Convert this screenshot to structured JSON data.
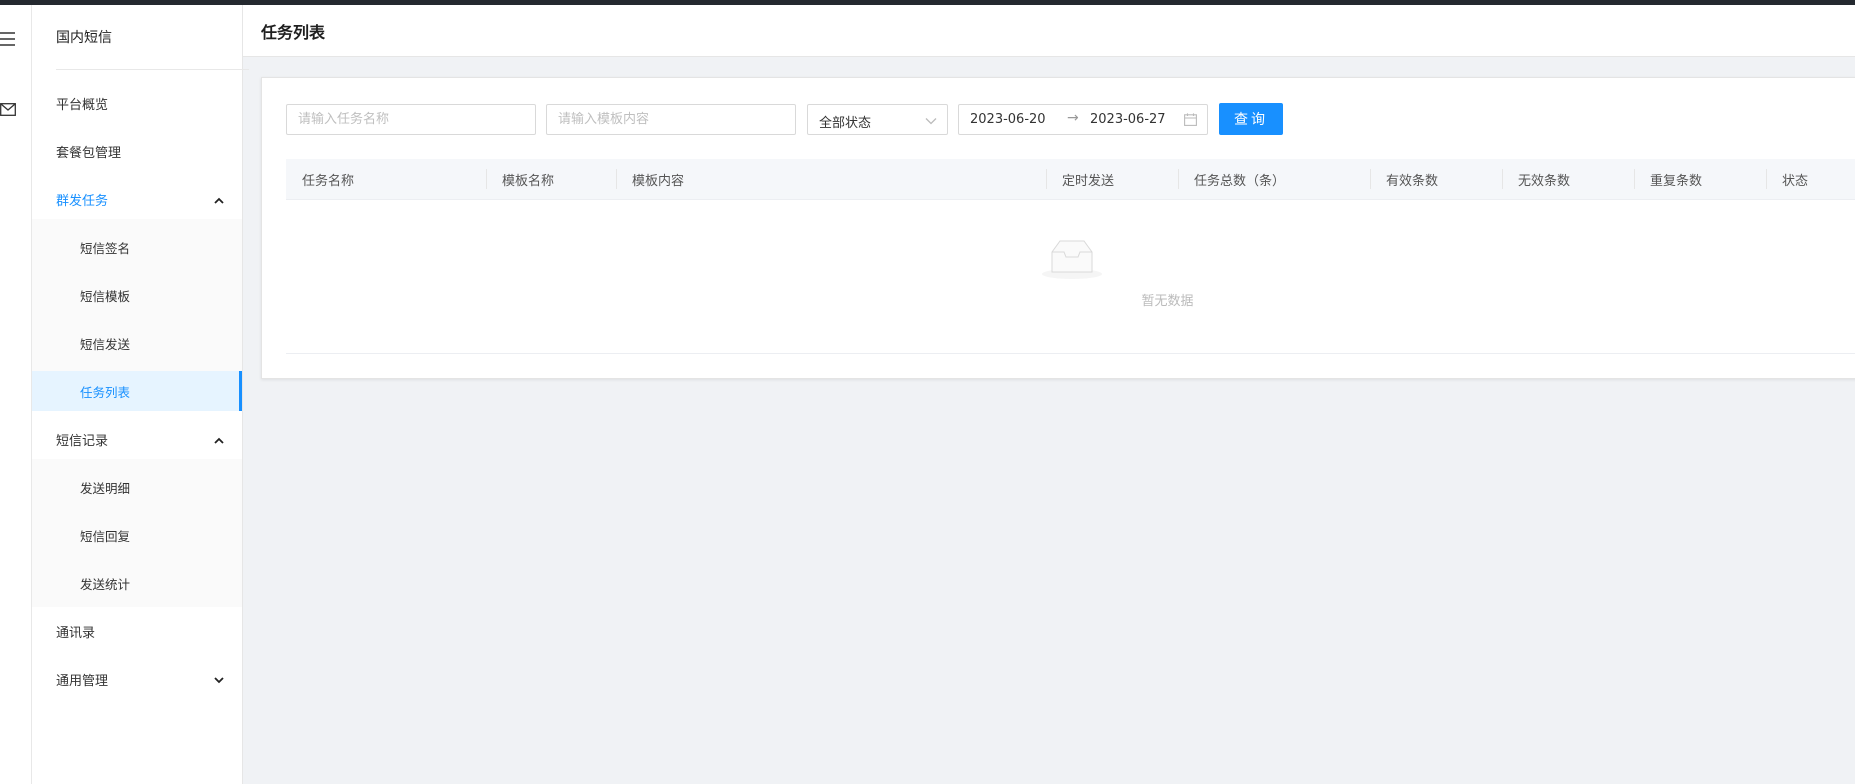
{
  "sidebar": {
    "title": "国内短信",
    "items": [
      {
        "label": "平台概览"
      },
      {
        "label": "套餐包管理"
      },
      {
        "label": "群发任务",
        "children": [
          {
            "label": "短信签名"
          },
          {
            "label": "短信模板"
          },
          {
            "label": "短信发送"
          },
          {
            "label": "任务列表"
          }
        ]
      },
      {
        "label": "短信记录",
        "children": [
          {
            "label": "发送明细"
          },
          {
            "label": "短信回复"
          },
          {
            "label": "发送统计"
          }
        ]
      },
      {
        "label": "通讯录"
      },
      {
        "label": "通用管理"
      }
    ]
  },
  "header": {
    "title": "任务列表"
  },
  "filters": {
    "task_name_placeholder": "请输入任务名称",
    "template_content_placeholder": "请输入模板内容",
    "status_selected": "全部状态",
    "date_start": "2023-06-20",
    "date_separator": "→",
    "date_end": "2023-06-27",
    "query_label": "查询"
  },
  "table": {
    "columns": [
      "任务名称",
      "模板名称",
      "模板内容",
      "定时发送",
      "任务总数（条）",
      "有效条数",
      "无效条数",
      "重复条数",
      "状态"
    ],
    "empty_text": "暂无数据"
  },
  "colors": {
    "primary": "#1890ff",
    "topbar": "#24292f",
    "background": "#f0f2f5"
  },
  "icons": {
    "rail": [
      "menu-icon",
      "mail-icon"
    ],
    "date": "calendar-icon",
    "empty": "empty-inbox-icon"
  }
}
